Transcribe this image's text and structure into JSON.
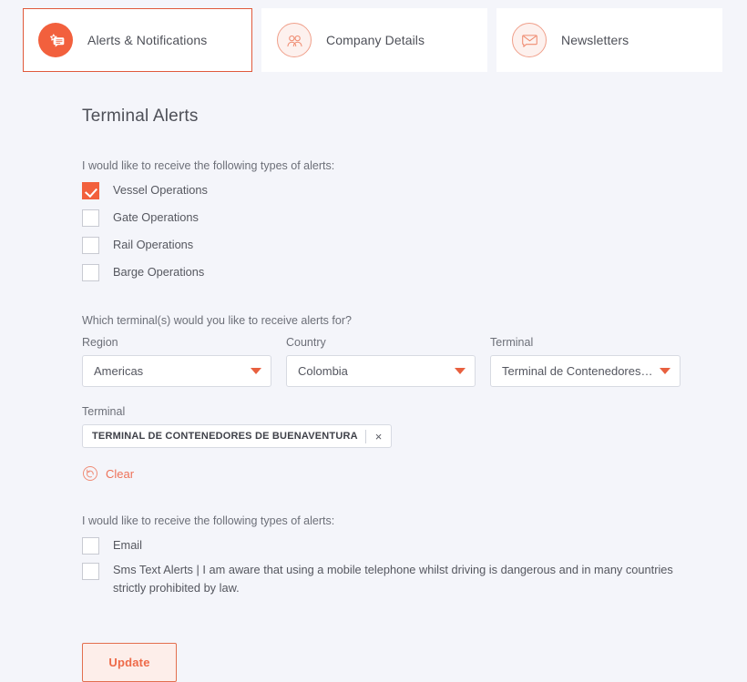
{
  "theme": {
    "accent": "#f2603d",
    "accent_light": "#ee7259",
    "page_bg": "#f4f5fa",
    "card_bg": "#ffffff",
    "text": "#54565f",
    "border": "#d7dae2"
  },
  "tabs": [
    {
      "label": "Alerts & Notifications",
      "icon": "alerts-chat-star-icon",
      "active": true
    },
    {
      "label": "Company Details",
      "icon": "people-group-icon",
      "active": false
    },
    {
      "label": "Newsletters",
      "icon": "envelope-icon",
      "active": false
    }
  ],
  "page": {
    "title": "Terminal Alerts"
  },
  "alert_types": {
    "label": "I would like to receive the following types of alerts:",
    "options": [
      {
        "label": "Vessel Operations",
        "checked": true
      },
      {
        "label": "Gate Operations",
        "checked": false
      },
      {
        "label": "Rail Operations",
        "checked": false
      },
      {
        "label": "Barge Operations",
        "checked": false
      }
    ]
  },
  "terminal_question": {
    "label": "Which terminal(s) would you like to receive alerts for?",
    "selects": [
      {
        "label": "Region",
        "value": "Americas"
      },
      {
        "label": "Country",
        "value": "Colombia"
      },
      {
        "label": "Terminal",
        "value": "Terminal de Contenedores de…"
      }
    ]
  },
  "selected_terminals": {
    "label": "Terminal",
    "chips": [
      {
        "text": "TERMINAL DE CONTENEDORES DE BUENAVENTURA",
        "remove_icon": "×"
      }
    ],
    "clear": {
      "label": "Clear",
      "icon": "reset-circular-arrow-icon"
    }
  },
  "delivery_types": {
    "label": "I would like to receive the following types of alerts:",
    "options": [
      {
        "label": "Email",
        "checked": false
      },
      {
        "label": "Sms Text Alerts | I am aware that using a mobile telephone whilst driving is dangerous and in many countries strictly prohibited by law.",
        "checked": false
      }
    ]
  },
  "actions": {
    "update_label": "Update"
  }
}
